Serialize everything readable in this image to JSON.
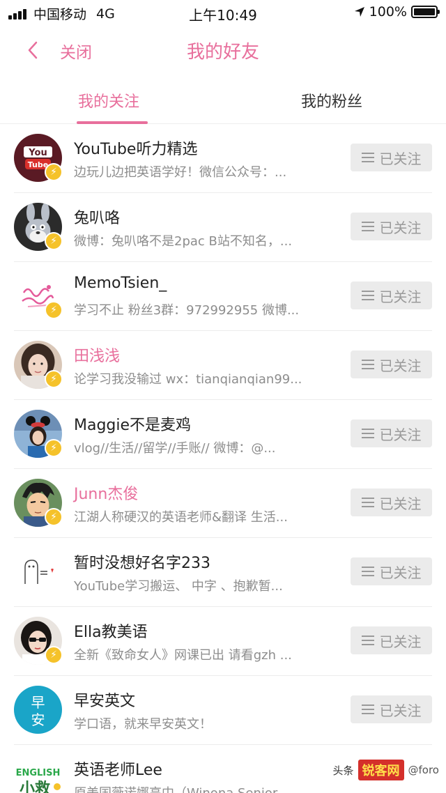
{
  "status_bar": {
    "carrier": "中国移动",
    "network": "4G",
    "time": "上午10:49",
    "battery": "100%"
  },
  "nav": {
    "close_label": "关闭",
    "title": "我的好友"
  },
  "tabs": [
    {
      "label": "我的关注",
      "active": true
    },
    {
      "label": "我的粉丝",
      "active": false
    }
  ],
  "follow_label": "已关注",
  "colors": {
    "accent": "#e86f9c",
    "badge": "#f5c22a"
  },
  "users": [
    {
      "name": "YouTube听力精选",
      "desc": "边玩儿边把英语学好！微信公众号：...",
      "highlight": false,
      "avatar": "youtube-logo",
      "badge": true
    },
    {
      "name": "兔叭咯",
      "desc": "微博：兔叭咯不是2pac B站不知名，...",
      "highlight": false,
      "avatar": "bugs-bunny",
      "badge": true
    },
    {
      "name": "MemoTsien_",
      "desc": "学习不止 粉丝3群：972992955 微博...",
      "highlight": false,
      "avatar": "pink-lettering",
      "badge": true
    },
    {
      "name": "田浅浅",
      "desc": "论学习我没输过 wx：tianqianqian99...",
      "highlight": true,
      "avatar": "girl-photo",
      "badge": true
    },
    {
      "name": "Maggie不是麦鸡",
      "desc": "vlog//生活//留学//手账// 微博：@...",
      "highlight": false,
      "avatar": "disney-photo",
      "badge": true
    },
    {
      "name": "Junn杰俊",
      "desc": "江湖人称硬汉的英语老师&翻译 生活...",
      "highlight": true,
      "avatar": "anime-boy",
      "badge": true
    },
    {
      "name": "暂时没想好名字233",
      "desc": "YouTube学习搬运、 中字 、抱歉暂...",
      "highlight": false,
      "avatar": "doodle",
      "badge": false
    },
    {
      "name": "Ella教美语",
      "desc": "全新《致命女人》网课已出 请看gzh ...",
      "highlight": false,
      "avatar": "woman-sunglasses",
      "badge": true
    },
    {
      "name": "早安英文",
      "desc": "学口语，就来早安英文！",
      "highlight": false,
      "avatar": "早安-logo",
      "badge": false
    },
    {
      "name": "英语老师Lee",
      "desc": "原美国薇诺娜高中（Winona Senior",
      "highlight": false,
      "avatar": "english-logo",
      "badge": false
    }
  ],
  "watermark": {
    "prefix": "头条",
    "brand": "锐客网",
    "handle": "@foro"
  }
}
